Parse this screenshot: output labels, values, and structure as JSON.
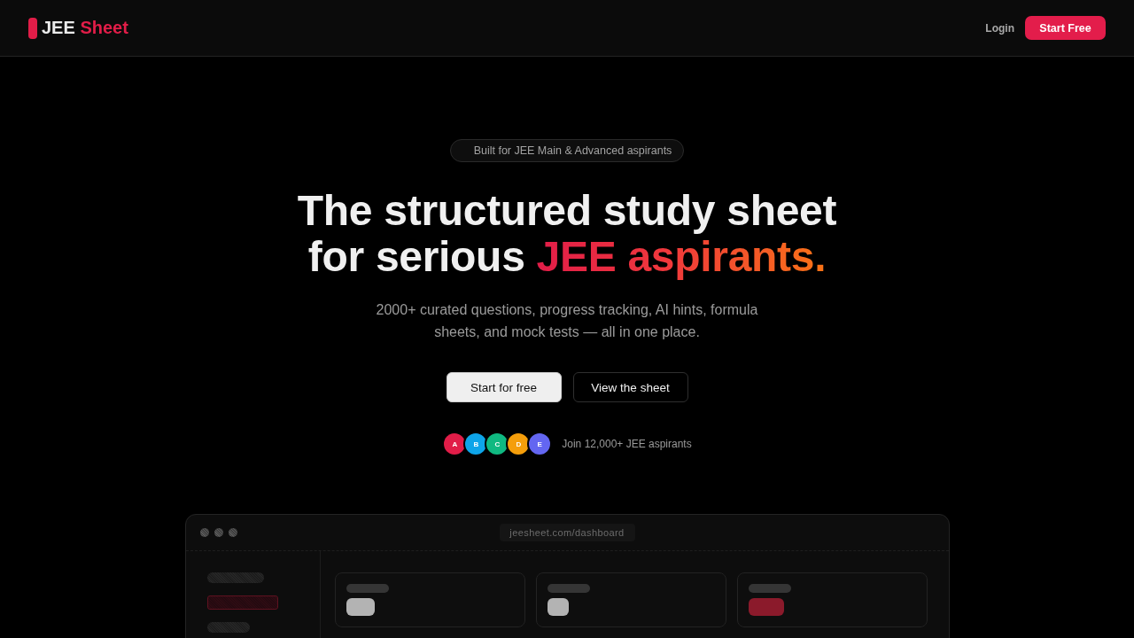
{
  "header": {
    "brand": {
      "name": "JEE",
      "accent": "Sheet"
    },
    "login": "Login",
    "cta": "Start Free"
  },
  "hero": {
    "badge": "Built for JEE Main & Advanced aspirants",
    "headline": {
      "line_1": "The structured study sheet",
      "line_2": "for serious",
      "highlight": "JEE aspirants."
    },
    "subtitle": "2000+ curated questions, progress tracking, AI hints, formula sheets, and mock tests — all in one place.",
    "buttons": [
      {
        "label": "Start for free",
        "kind": "primary"
      },
      {
        "label": "View the sheet",
        "kind": "secondary"
      }
    ],
    "avatars": [
      {
        "letter": "A",
        "color": "#e11d48"
      },
      {
        "letter": "B",
        "color": "#0ea5e9"
      },
      {
        "letter": "C",
        "color": "#10b981"
      },
      {
        "letter": "D",
        "color": "#f59e0b"
      },
      {
        "letter": "E",
        "color": "#6366f1"
      }
    ],
    "social_proof": "Join 12,000+ JEE aspirants"
  },
  "preview": {
    "url": "jeesheet.com/dashboard",
    "sidebar_items": [
      {
        "selected": false
      },
      {
        "selected": true
      },
      {
        "selected": false
      }
    ],
    "stat_cards": [
      {
        "color": "#b3b3b3"
      },
      {
        "color": "#b3b3b3"
      },
      {
        "color": "#8b1a2b"
      }
    ]
  }
}
